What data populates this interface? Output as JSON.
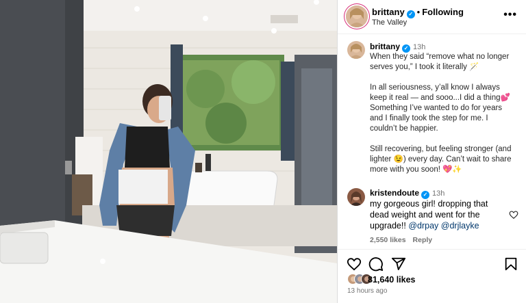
{
  "post": {
    "author": "brittany",
    "follow_status": "Following",
    "location": "The Valley",
    "time_ago": "13h",
    "caption": "When they said “remove what no longer serves you,” I took it literally 🪄\n\nIn all seriousness, y’all know I always keep it real — and sooo...I did a thing💕 Something I’ve wanted to do for years and I finally took the step for me. I couldn’t be happier.\n\nStill recovering, but feeling stronger (and lighter 😉) every day. Can’t wait to share more with you soon! 💖✨",
    "likes": "81,640 likes",
    "timestamp": "13 hours ago"
  },
  "comment": {
    "author": "kristendoute",
    "time_ago": "13h",
    "text": "my gorgeous girl! dropping that dead weight and went for the upgrade!!",
    "mentions": [
      "@drpay",
      "@drjlayke"
    ],
    "likes": "2,550 likes",
    "reply_label": "Reply"
  },
  "icons": {
    "header_more": "more-horizontal-icon",
    "comment_like": "heart-outline-icon",
    "like": "heart-icon",
    "comment": "comment-icon",
    "share": "share-icon",
    "save": "bookmark-icon",
    "verified": "verified-badge-icon"
  },
  "colors": {
    "verified": "#0095f6",
    "mention": "#00376b",
    "secondary_text": "#737373",
    "story_ring": "#d62976"
  }
}
